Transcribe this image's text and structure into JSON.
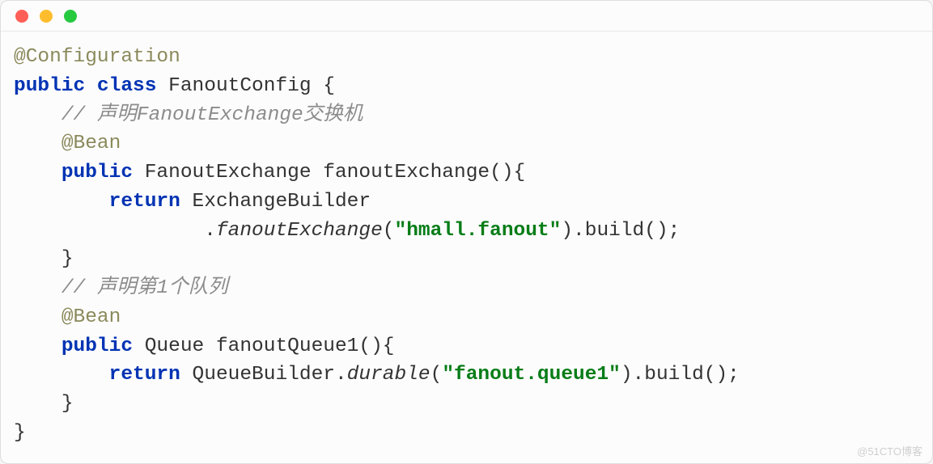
{
  "code": {
    "annotation_configuration": "@Configuration",
    "kw_public1": "public",
    "kw_class": "class",
    "class_name": "FanoutConfig",
    "brace_open": " {",
    "comment1": "// 声明FanoutExchange交换机",
    "annotation_bean1": "@Bean",
    "kw_public2": "public",
    "type_fanout_exchange": "FanoutExchange",
    "method_fanoutExchange": "fanoutExchange",
    "parens_empty_open": "(){",
    "kw_return1": "return",
    "type_exchange_builder": "ExchangeBuilder",
    "dot": ".",
    "method_fanoutExchange_call": "fanoutExchange",
    "paren_open": "(",
    "string_hmall": "\"hmall.fanout\"",
    "paren_close_build": ").build();",
    "brace_close1": "}",
    "comment2": "// 声明第1个队列",
    "annotation_bean2": "@Bean",
    "kw_public3": "public",
    "type_queue": "Queue",
    "method_fanoutQueue1": "fanoutQueue1",
    "parens_empty_open2": "(){",
    "kw_return2": "return",
    "type_queue_builder": "QueueBuilder",
    "method_durable": "durable",
    "string_queue1": "\"fanout.queue1\"",
    "paren_close_build2": ").build();",
    "brace_close2": "}",
    "brace_close3": "}"
  },
  "watermark": "@51CTO博客"
}
